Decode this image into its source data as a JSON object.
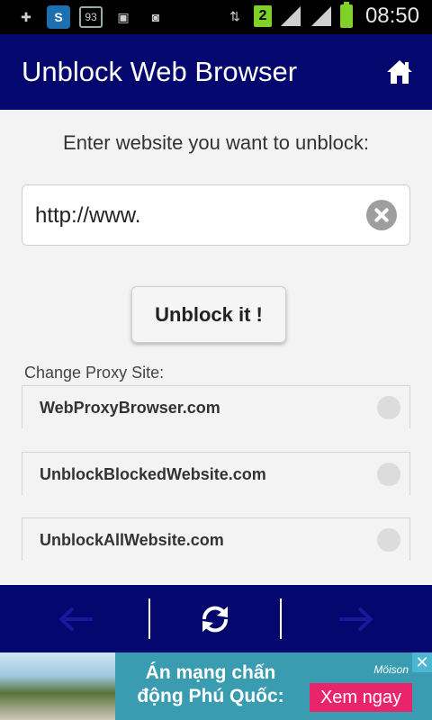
{
  "status_bar": {
    "badge_number": "93",
    "notification_count": "2",
    "time": "08:50"
  },
  "app_bar": {
    "title": "Unblock Web Browser",
    "home_icon": "home-icon"
  },
  "main": {
    "prompt": "Enter website you want to unblock:",
    "url_input": {
      "value": "http://www."
    },
    "unblock_button": "Unblock it !",
    "proxy_label": "Change Proxy Site:",
    "proxy_sites": [
      "WebProxyBrowser.com",
      "UnblockBlockedWebsite.com",
      "UnblockAllWebsite.com"
    ]
  },
  "bottom_bar": {
    "back_icon": "arrow-left-icon",
    "refresh_icon": "refresh-icon",
    "forward_icon": "arrow-right-icon"
  },
  "ad": {
    "headline_line1": "Án mạng chấn",
    "headline_line2": "động Phú Quốc:",
    "brand": "Möison",
    "cta": "Xem ngay",
    "close": "✕"
  },
  "colors": {
    "primary": "#03076e",
    "ad_cta": "#e8256a",
    "status_green": "#7fd12a"
  }
}
